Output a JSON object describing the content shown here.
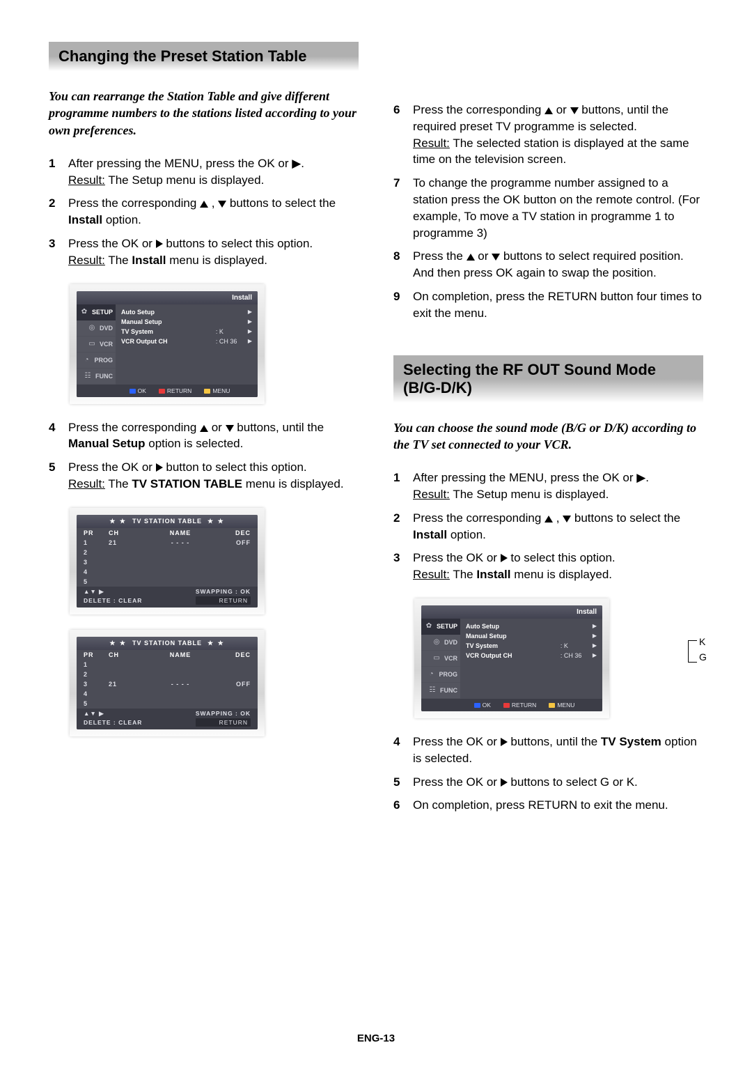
{
  "page_number": "ENG-13",
  "sections": {
    "preset": {
      "heading": "Changing the Preset Station Table",
      "intro": "You can rearrange the Station Table and give different programme numbers to the stations listed according to your own preferences.",
      "steps_left": {
        "s1": "After pressing the MENU, press the OK or ▶.",
        "s1_result_label": "Result:",
        "s1_result": " The Setup menu is displayed.",
        "s2_a": "Press the corresponding ",
        "s2_b": " , ",
        "s2_c": " buttons to select the ",
        "s2_install": "Install",
        "s2_d": " option.",
        "s3_a": "Press the OK or ",
        "s3_b": " buttons to select this option.",
        "s3_result_label": "Result:",
        "s3_result_a": " The ",
        "s3_install": "Install",
        "s3_result_b": " menu is displayed.",
        "s4_a": "Press the corresponding ",
        "s4_or": " or ",
        "s4_b": " buttons, until the ",
        "s4_manual": "Manual Setup",
        "s4_c": " option is selected.",
        "s5_a": "Press the OK or ",
        "s5_b": " button to select this option.",
        "s5_result_label": "Result:",
        "s5_result_a": " The ",
        "s5_tv": "TV STATION TABLE",
        "s5_result_b": " menu is displayed."
      },
      "steps_right": {
        "s6_a": "Press the corresponding ",
        "s6_or": " or ",
        "s6_b": " buttons, until the required preset TV programme is selected.",
        "s6_result_label": "Result:",
        "s6_result": " The selected station is displayed at the same time on the television screen.",
        "s7": "To change the programme number assigned to a station press the OK button on the remote control. (For example, To move a TV station in programme 1 to programme 3)",
        "s8_a": "Press the ",
        "s8_or": " or ",
        "s8_b": " buttons to select required position. And then press OK again to swap the position.",
        "s9": "On completion, press the RETURN button four times to exit the menu."
      }
    },
    "rfout": {
      "heading": "Selecting the RF OUT Sound Mode (B/G-D/K)",
      "intro": "You can choose the sound mode (B/G or D/K) according to the TV set connected to your VCR.",
      "s1": "After pressing the MENU, press the OK or ▶.",
      "s1_result_label": "Result:",
      "s1_result": " The Setup menu is displayed.",
      "s2_a": "Press the corresponding ",
      "s2_b": " , ",
      "s2_c": " buttons to select the ",
      "s2_install": "Install",
      "s2_d": " option.",
      "s3_a": "Press the OK or ",
      "s3_b": " to select this option.",
      "s3_result_label": "Result:",
      "s3_result_a": " The ",
      "s3_install": "Install",
      "s3_result_b": " menu is displayed.",
      "s4_a": "Press the OK or ",
      "s4_b": " buttons, until the ",
      "s4_tv": "TV System",
      "s4_c": " option is selected.",
      "s5_a": "Press the OK or ",
      "s5_b": " buttons to select G or K.",
      "s6": "On completion, press RETURN to exit the menu."
    }
  },
  "osd_install": {
    "title": "Install",
    "side": [
      "SETUP",
      "DVD",
      "VCR",
      "PROG",
      "FUNC"
    ],
    "rows": [
      {
        "label": "Auto Setup",
        "val": "",
        "arrow": "▶"
      },
      {
        "label": "Manual Setup",
        "val": "",
        "arrow": "▶"
      },
      {
        "label": "TV System",
        "val": ": K",
        "arrow": "▶"
      },
      {
        "label": "VCR Output CH",
        "val": ": CH 36",
        "arrow": "▶"
      }
    ],
    "foot": {
      "ok": "OK",
      "return": "RETURN",
      "menu": "MENU"
    },
    "anno": {
      "k": "K",
      "g": "G"
    }
  },
  "station_tables": {
    "title": "TV STATION TABLE",
    "stars": "★ ★",
    "head": {
      "pr": "PR",
      "ch": "CH",
      "name": "NAME",
      "dec": "DEC"
    },
    "table_a": [
      {
        "pr": "1",
        "ch": "21",
        "name": "-  -  -  -",
        "dec": "OFF"
      },
      {
        "pr": "2",
        "ch": "",
        "name": "",
        "dec": ""
      },
      {
        "pr": "3",
        "ch": "",
        "name": "",
        "dec": ""
      },
      {
        "pr": "4",
        "ch": "",
        "name": "",
        "dec": ""
      },
      {
        "pr": "5",
        "ch": "",
        "name": "",
        "dec": ""
      }
    ],
    "table_b": [
      {
        "pr": "1",
        "ch": "",
        "name": "",
        "dec": ""
      },
      {
        "pr": "2",
        "ch": "",
        "name": "",
        "dec": ""
      },
      {
        "pr": "3",
        "ch": "21",
        "name": "-  -  -  -",
        "dec": "OFF"
      },
      {
        "pr": "4",
        "ch": "",
        "name": "",
        "dec": ""
      },
      {
        "pr": "5",
        "ch": "",
        "name": "",
        "dec": ""
      }
    ],
    "foot": {
      "nav": "▲▼ ▶",
      "delete": "DELETE : CLEAR",
      "swap": "SWAPPING : OK",
      "return": "RETURN"
    }
  }
}
